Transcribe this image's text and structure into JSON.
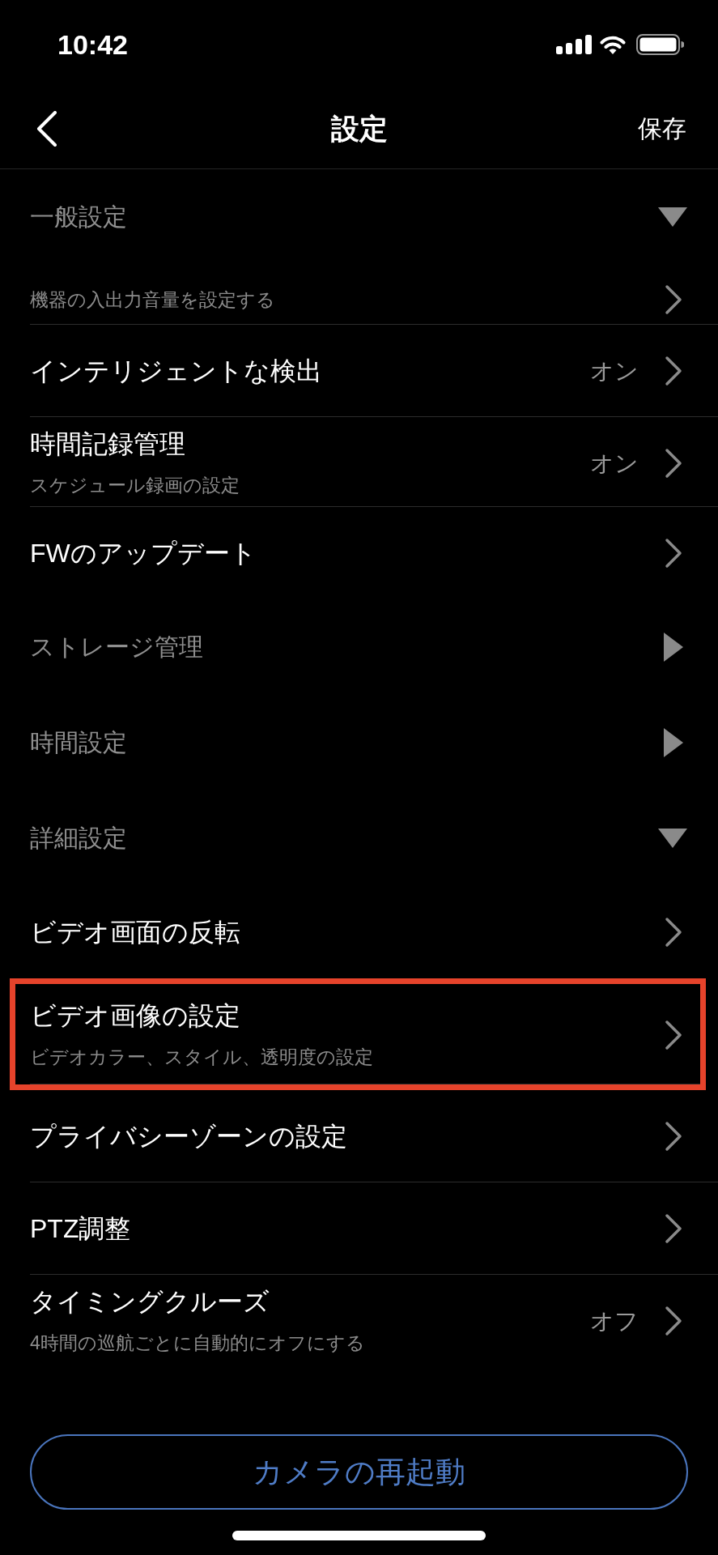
{
  "status_bar": {
    "time": "10:42"
  },
  "nav_bar": {
    "title": "設定",
    "action": "保存"
  },
  "sections": [
    {
      "title": "一般設定",
      "expanded": true,
      "items": [
        {
          "subtitle": "機器の入出力音量を設定する",
          "highlighted": false
        },
        {
          "title": "インテリジェントな検出",
          "value": "オン",
          "highlighted": false
        },
        {
          "title": "時間記録管理",
          "subtitle": "スケジュール録画の設定",
          "value": "オン",
          "highlighted": false
        },
        {
          "title": "FWのアップデート",
          "highlighted": false
        }
      ]
    },
    {
      "title": "ストレージ管理",
      "expanded": false
    },
    {
      "title": "時間設定",
      "expanded": false
    },
    {
      "title": "詳細設定",
      "expanded": true,
      "items": [
        {
          "title": "ビデオ画面の反転",
          "highlighted": false
        },
        {
          "title": "ビデオ画像の設定",
          "subtitle": "ビデオカラー、スタイル、透明度の設定",
          "highlighted": true
        },
        {
          "title": "プライバシーゾーンの設定",
          "highlighted": false
        },
        {
          "title": "PTZ調整",
          "highlighted": false
        },
        {
          "title": "タイミングクルーズ",
          "subtitle": "4時間の巡航ごとに自動的にオフにする",
          "value": "オフ",
          "highlighted": false
        }
      ]
    }
  ],
  "restart_button": {
    "label": "カメラの再起動"
  }
}
